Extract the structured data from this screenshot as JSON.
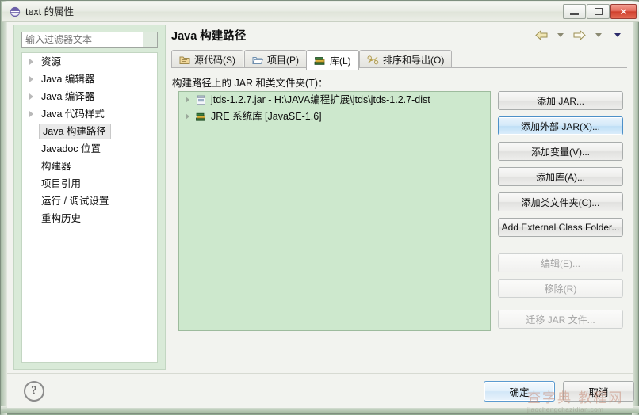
{
  "window": {
    "title": "text 的属性",
    "icon": "eclipse-properties-icon",
    "controls": {
      "minimize": "minimize-button",
      "maximize": "maximize-button",
      "close": "✕"
    }
  },
  "sidebar": {
    "filter": {
      "value": "",
      "placeholder": "输入过滤器文本"
    },
    "items": [
      {
        "label": "资源",
        "expandable": true,
        "selected": false
      },
      {
        "label": "Java 编辑器",
        "expandable": true,
        "selected": false
      },
      {
        "label": "Java 编译器",
        "expandable": true,
        "selected": false
      },
      {
        "label": "Java 代码样式",
        "expandable": true,
        "selected": false
      },
      {
        "label": "Java 构建路径",
        "expandable": false,
        "selected": true
      },
      {
        "label": "Javadoc 位置",
        "expandable": false,
        "selected": false
      },
      {
        "label": "构建器",
        "expandable": false,
        "selected": false
      },
      {
        "label": "项目引用",
        "expandable": false,
        "selected": false
      },
      {
        "label": "运行 / 调试设置",
        "expandable": false,
        "selected": false
      },
      {
        "label": "重构历史",
        "expandable": false,
        "selected": false
      }
    ]
  },
  "content": {
    "title": "Java 构建路径",
    "nav": {
      "back": "back-arrow",
      "back_menu": "back-dropdown",
      "forward": "forward-arrow",
      "forward_menu": "forward-dropdown",
      "view_menu": "view-menu-dropdown"
    },
    "tabs": [
      {
        "label": "源代码(S)",
        "icon": "source-folder-icon",
        "active": false
      },
      {
        "label": "项目(P)",
        "icon": "project-folder-icon",
        "active": false
      },
      {
        "label": "库(L)",
        "icon": "library-books-icon",
        "active": true
      },
      {
        "label": "排序和导出(O)",
        "icon": "order-export-icon",
        "active": false
      }
    ],
    "sub_label": "构建路径上的 JAR 和类文件夹(T)：",
    "entries": [
      {
        "label": "jtds-1.2.7.jar  -  H:\\JAVA编程扩展\\jtds\\jtds-1.2.7-dist",
        "icon": "jar-file-icon",
        "expandable": true
      },
      {
        "label": "JRE 系统库 [JavaSE-1.6]",
        "icon": "jre-library-icon",
        "expandable": true
      }
    ],
    "side_buttons": [
      {
        "label": "添加 JAR...",
        "state": "normal"
      },
      {
        "label": "添加外部 JAR(X)...",
        "state": "focus"
      },
      {
        "label": "添加变量(V)...",
        "state": "normal"
      },
      {
        "label": "添加库(A)...",
        "state": "normal"
      },
      {
        "label": "添加类文件夹(C)...",
        "state": "normal"
      },
      {
        "label": "Add External Class Folder...",
        "state": "normal"
      },
      {
        "label": "编辑(E)...",
        "state": "disabled"
      },
      {
        "label": "移除(R)",
        "state": "disabled"
      },
      {
        "label": "迁移 JAR 文件...",
        "state": "disabled"
      }
    ]
  },
  "footer": {
    "help": "?",
    "ok_label": "确定",
    "cancel_label": "取消"
  },
  "watermark": {
    "main": "查字典 教程网",
    "sub": "jiaochengchazidian.com"
  },
  "colors": {
    "list_background": "#cde8cd",
    "sidebar_background": "#d9ead8",
    "accent_focus": "#4d90c8",
    "close_button": "#cf3f2c"
  }
}
